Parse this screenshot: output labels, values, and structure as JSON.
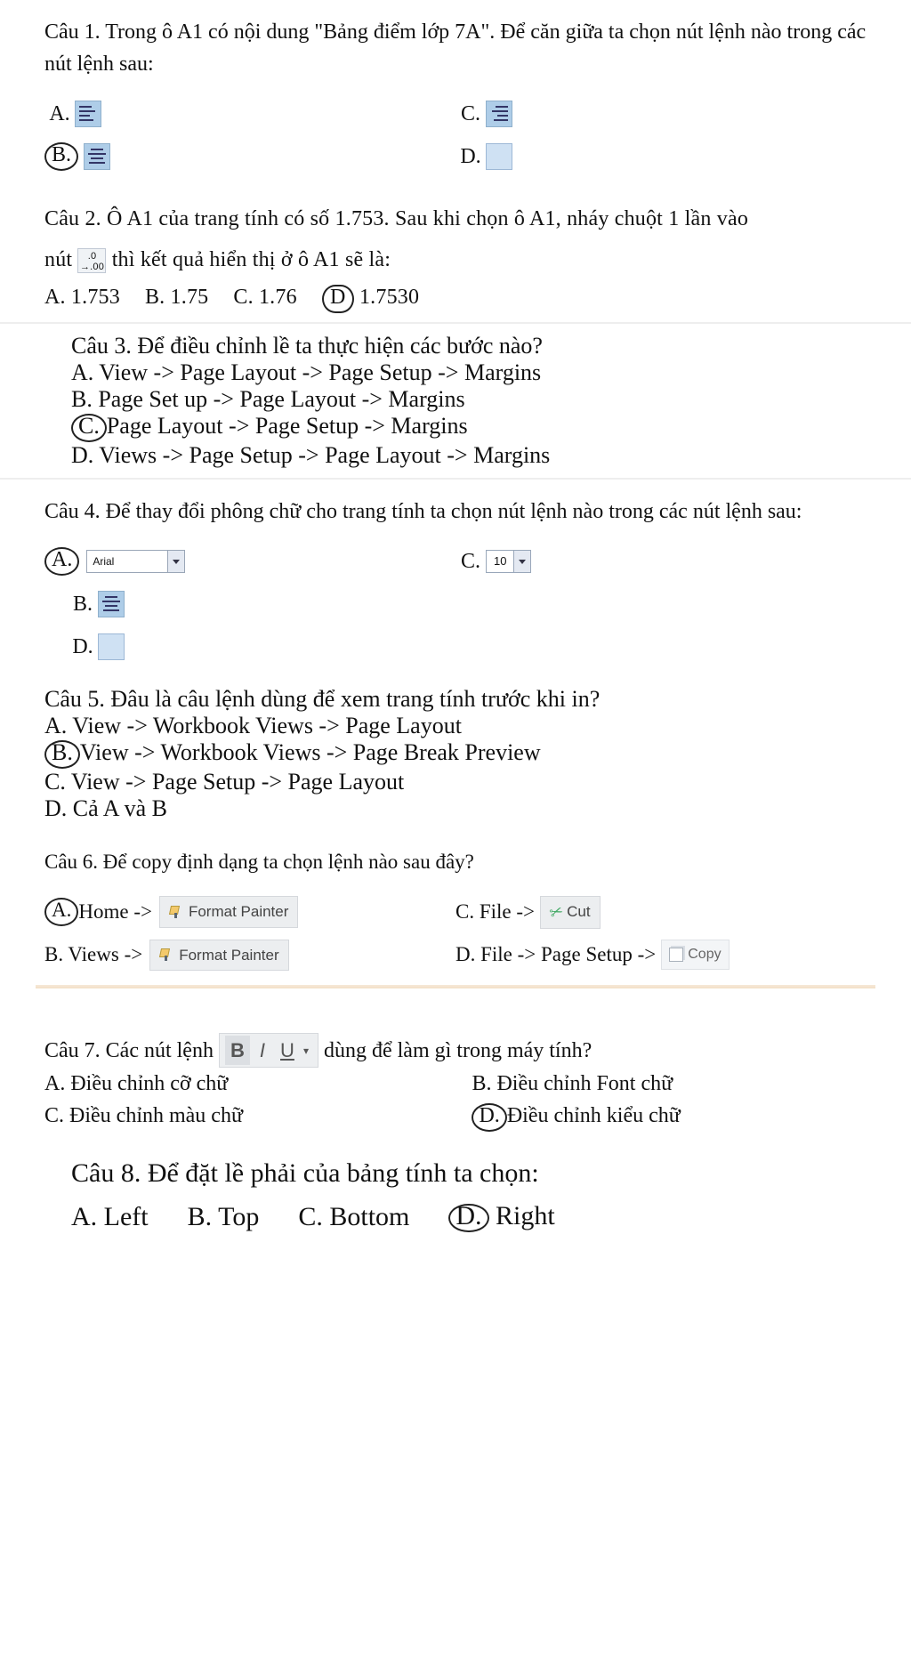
{
  "q1": {
    "prompt": "Câu 1. Trong ô A1 có nội dung \"Bảng điểm lớp 7A\". Để căn giữa ta chọn nút lệnh nào trong các nút lệnh sau:",
    "A": "A.",
    "B": "B.",
    "C": "C.",
    "D": "D.",
    "circled": "B"
  },
  "q2": {
    "line1": "Câu 2. Ô A1 của trang tính có số 1.753. Sau khi chọn ô A1, nháy chuột 1 lần vào",
    "nut": "nút",
    "line2": " thì kết quả hiển thị ở ô A1 sẽ là:",
    "A": "A. 1.753",
    "B": "B. 1.75",
    "C": "C. 1.76",
    "D": "D  1.7530",
    "icon_label": ".0→.00"
  },
  "q3": {
    "prompt": "Câu 3. Để điều chỉnh lề ta thực hiện các bước nào?",
    "A": "A. View -> Page Layout -> Page Setup -> Margins",
    "B": "B. Page Set up -> Page Layout -> Margins",
    "C_letter": "C.",
    "C_text": "Page Layout -> Page Setup -> Margins",
    "D": "D. Views -> Page Setup -> Page Layout -> Margins"
  },
  "q4": {
    "prompt": "Câu 4. Để thay đổi phông chữ cho trang tính ta chọn nút lệnh nào trong các nút lệnh sau:",
    "A": "A.",
    "B": "B.",
    "C": "C.",
    "D": "D.",
    "font_name": "Arial",
    "font_size": "10"
  },
  "q5": {
    "prompt": "Câu 5. Đâu là câu lệnh dùng để xem trang tính trước khi in?",
    "A": "A. View -> Workbook Views -> Page Layout",
    "B_letter": "B.",
    "B_text": "View -> Workbook Views -> Page Break Preview",
    "C": "C. View -> Page Setup -> Page Layout",
    "D": "D. Cả A và B"
  },
  "q6": {
    "prompt": "Câu 6. Để copy định dạng ta chọn lệnh nào sau đây?",
    "A_letter": "A.",
    "A_text": "Home ->",
    "B": "B. Views ->",
    "C": "C. File ->",
    "D": "D. File -> Page Setup ->",
    "fp": "Format Painter",
    "cut": "Cut",
    "copy": "Copy"
  },
  "q7": {
    "lead": "Câu 7. Các nút lệnh",
    "tail": " dùng để làm gì trong máy tính?",
    "A": "A. Điều chỉnh cỡ chữ",
    "B": "B. Điều chỉnh Font chữ",
    "C": "C. Điều chỉnh màu chữ",
    "D_letter": "D.",
    "D_text": "Điều chỉnh kiểu chữ",
    "b": "B",
    "i": "I",
    "u": "U"
  },
  "q8": {
    "prompt": "Câu 8. Để đặt lề phải của bảng tính ta chọn:",
    "A": "A. Left",
    "B": "B. Top",
    "C": "C. Bottom",
    "D_letter": "D.",
    "D_text": " Right"
  }
}
